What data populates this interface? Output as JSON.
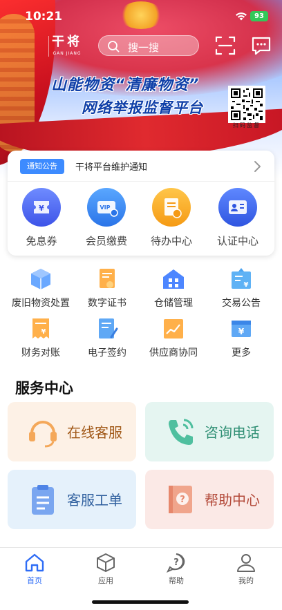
{
  "status": {
    "time": "10:21",
    "battery": "93"
  },
  "header": {
    "brand_main": "干将",
    "brand_sub": "GAN JIANG",
    "search_placeholder": "搜一搜"
  },
  "banner": {
    "line1": "山能物资“清廉物资”",
    "line2": "网络举报监督平台",
    "qr_caption": "扫码监督"
  },
  "notice": {
    "badge": "通知公告",
    "text": "干将平台维护通知"
  },
  "quick_actions": [
    {
      "label": "免息券",
      "icon": "coupon-icon"
    },
    {
      "label": "会员缴费",
      "icon": "vip-card-icon"
    },
    {
      "label": "待办中心",
      "icon": "todo-icon"
    },
    {
      "label": "认证中心",
      "icon": "id-card-icon"
    }
  ],
  "services": [
    {
      "label": "废旧物资处置",
      "icon": "box-icon"
    },
    {
      "label": "数字证书",
      "icon": "certificate-icon"
    },
    {
      "label": "仓储管理",
      "icon": "warehouse-icon"
    },
    {
      "label": "交易公告",
      "icon": "announcement-icon"
    },
    {
      "label": "财务对账",
      "icon": "bill-icon"
    },
    {
      "label": "电子签约",
      "icon": "contract-icon"
    },
    {
      "label": "供应商协同",
      "icon": "chart-icon"
    },
    {
      "label": "更多",
      "icon": "more-icon"
    }
  ],
  "service_center": {
    "title": "服务中心",
    "tiles": [
      {
        "label": "在线客服",
        "icon": "headset-icon"
      },
      {
        "label": "咨询电话",
        "icon": "phone-icon"
      },
      {
        "label": "客服工单",
        "icon": "clipboard-icon"
      },
      {
        "label": "帮助中心",
        "icon": "help-book-icon"
      }
    ]
  },
  "tabs": [
    {
      "label": "首页",
      "active": true
    },
    {
      "label": "应用",
      "active": false
    },
    {
      "label": "帮助",
      "active": false
    },
    {
      "label": "我的",
      "active": false
    }
  ],
  "colors": {
    "accent": "#3d8bff",
    "tab_active": "#2f6df6",
    "brand_red": "#d9161f",
    "banner_text": "#0f3fa8"
  }
}
